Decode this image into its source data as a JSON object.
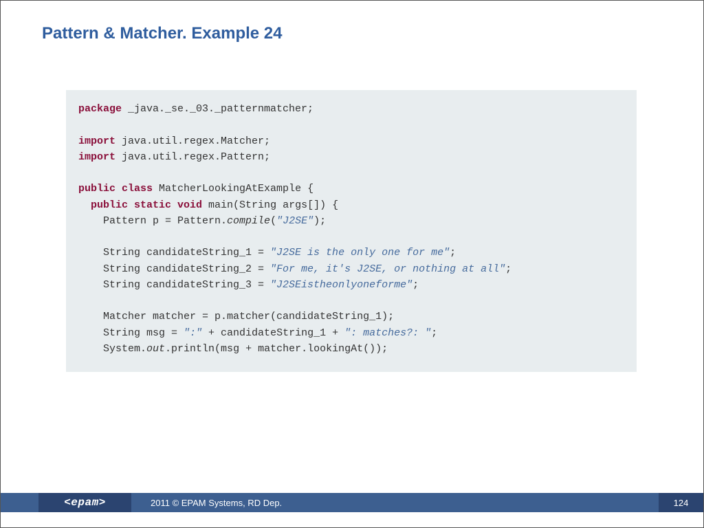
{
  "title": "Pattern & Matcher. Example 24",
  "code": {
    "l1_kw": "package",
    "l1_rest": " _java._se._03._patternmatcher;",
    "l2_kw": "import",
    "l2_rest": " java.util.regex.Matcher;",
    "l3_kw": "import",
    "l3_rest": " java.util.regex.Pattern;",
    "l4_kw": "public class",
    "l4_rest": " MatcherLookingAtExample {",
    "l5_pad": "  ",
    "l5_kw": "public static void",
    "l5_rest": " main(String args[]) {",
    "l6_a": "    Pattern p = Pattern.",
    "l6_em": "compile",
    "l6_b": "(",
    "l6_str": "\"J2SE\"",
    "l6_c": ");",
    "l7_a": "    String candidateString_1 = ",
    "l7_str": "\"J2SE is the only one for me\"",
    "l7_b": ";",
    "l8_a": "    String candidateString_2 = ",
    "l8_str": "\"For me, it's J2SE, or nothing at all\"",
    "l8_b": ";",
    "l9_a": "    String candidateString_3 = ",
    "l9_str": "\"J2SEistheonlyoneforme\"",
    "l9_b": ";",
    "l10": "    Matcher matcher = p.matcher(candidateString_1);",
    "l11_a": "    String msg = ",
    "l11_s1": "\":\"",
    "l11_b": " + candidateString_1 + ",
    "l11_s2": "\": matches?: \"",
    "l11_c": ";",
    "l12_a": "    System.",
    "l12_em": "out",
    "l12_b": ".println(msg + matcher.lookingAt());"
  },
  "footer": {
    "logo": "<epam>",
    "copyright": "2011 © EPAM Systems, RD Dep.",
    "page": "124"
  }
}
